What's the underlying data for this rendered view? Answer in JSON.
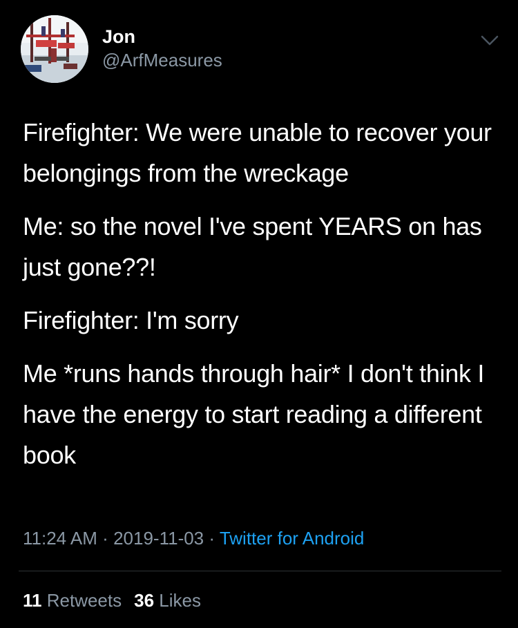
{
  "author": {
    "name": "Jon",
    "handle": "@ArfMeasures",
    "avatar_icon": "avatar-playground-photo"
  },
  "tweet": {
    "paragraphs": [
      "Firefighter: We were unable to recover your belongings from the wreckage",
      "Me: so the novel I've spent YEARS on has just gone??!",
      "Firefighter: I'm sorry",
      "Me *runs hands through hair* I don't think I have the energy to start reading a different book"
    ],
    "time": "11:24 AM",
    "separator": "·",
    "date": "2019-11-03",
    "source": "Twitter for Android"
  },
  "stats": {
    "retweets_count": "11",
    "retweets_label": "Retweets",
    "likes_count": "36",
    "likes_label": "Likes"
  },
  "colors": {
    "background": "#000000",
    "text": "#ffffff",
    "secondary": "#8b98a5",
    "link": "#1da1f2"
  },
  "icons": {
    "menu": "chevron-down-icon"
  }
}
